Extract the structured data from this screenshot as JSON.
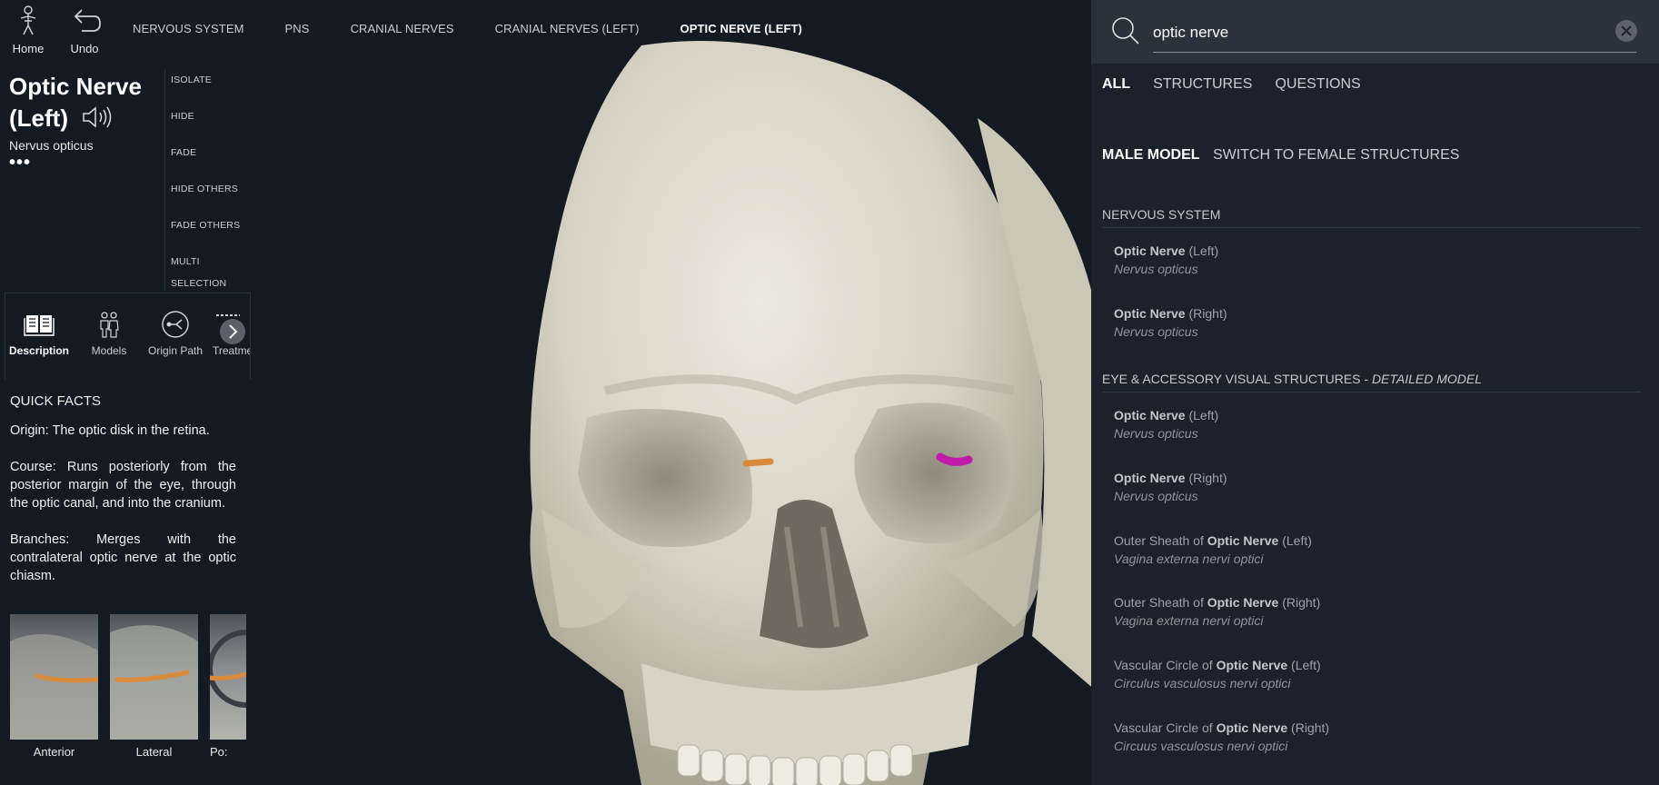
{
  "topbar": {
    "home_label": "Home",
    "undo_label": "Undo",
    "breadcrumbs": [
      "NERVOUS SYSTEM",
      "PNS",
      "CRANIAL NERVES",
      "CRANIAL NERVES (LEFT)",
      "OPTIC NERVE (LEFT)"
    ]
  },
  "structure": {
    "title": "Optic Nerve (Left)",
    "latin": "Nervus opticus",
    "more": "•••"
  },
  "actions": [
    "ISOLATE",
    "HIDE",
    "FADE",
    "HIDE OTHERS",
    "FADE OTHERS",
    "MULTI SELECTION"
  ],
  "tabs": [
    "Description",
    "Models",
    "Origin Path",
    "Treatme"
  ],
  "facts": {
    "heading": "QUICK FACTS",
    "origin": "Origin: The optic disk in the retina.",
    "course": "Course: Runs posteriorly from the posterior margin of the eye, through the optic canal, and into the cranium.",
    "branches": "Branches: Merges with the contralateral optic nerve at the optic chiasm."
  },
  "thumbnails": [
    "Anterior",
    "Lateral",
    "Po:"
  ],
  "search": {
    "query": "optic nerve",
    "tabs": [
      "ALL",
      "STRUCTURES",
      "QUESTIONS"
    ],
    "model": "MALE MODEL",
    "switch": "SWITCH TO FEMALE STRUCTURES",
    "section1": "NERVOUS SYSTEM",
    "section2_main": "EYE & ACCESSORY VISUAL STRUCTURES - ",
    "section2_sub": "DETAILED MODEL",
    "results": [
      {
        "pre": "",
        "bold": "Optic Nerve",
        "post": " (Left)",
        "latin": "Nervus opticus"
      },
      {
        "pre": "",
        "bold": "Optic Nerve",
        "post": " (Right)",
        "latin": "Nervus opticus"
      },
      {
        "pre": "",
        "bold": "Optic Nerve",
        "post": " (Left)",
        "latin": "Nervus opticus"
      },
      {
        "pre": "",
        "bold": "Optic Nerve",
        "post": " (Right)",
        "latin": "Nervus opticus"
      },
      {
        "pre": "Outer Sheath of ",
        "bold": "Optic Nerve",
        "post": " (Left)",
        "latin": "Vagina externa nervi optici"
      },
      {
        "pre": "Outer Sheath of ",
        "bold": "Optic Nerve",
        "post": " (Right)",
        "latin": "Vagina externa nervi optici"
      },
      {
        "pre": "Vascular Circle of ",
        "bold": "Optic Nerve",
        "post": " (Left)",
        "latin": "Circulus vasculosus nervi optici"
      },
      {
        "pre": "Vascular Circle of ",
        "bold": "Optic Nerve",
        "post": " (Right)",
        "latin": "Circuus vasculosus nervi optici"
      }
    ]
  },
  "colors": {
    "background": "#141a22",
    "panel": "#1c232c",
    "highlight_nerve": "#c21aa8",
    "other_nerve": "#d98a3a",
    "bone": "#d9d5c6"
  }
}
